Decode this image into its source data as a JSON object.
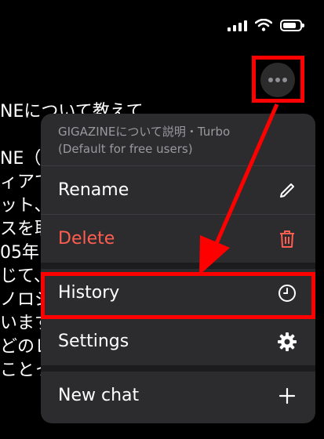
{
  "background_lines": [
    "NEについて教えて",
    "",
    "NE（",
    "ィアで",
    "ット、",
    "スを取",
    "05年",
    "じて、",
    "ノロジ",
    "います",
    "どのレ",
    "ことっ"
  ],
  "menu": {
    "header_line1": "GIGAZINEについて説明・Turbo",
    "header_line2": "(Default for free users)",
    "items": [
      {
        "label": "Rename",
        "icon": "pencil-icon"
      },
      {
        "label": "Delete",
        "icon": "trash-icon"
      },
      {
        "label": "History",
        "icon": "clock-icon"
      },
      {
        "label": "Settings",
        "icon": "gear-icon"
      },
      {
        "label": "New chat",
        "icon": "plus-icon"
      }
    ]
  },
  "colors": {
    "highlight": "#ff0000",
    "danger": "#ff5e50",
    "menu_bg": "#2c2c2e"
  }
}
